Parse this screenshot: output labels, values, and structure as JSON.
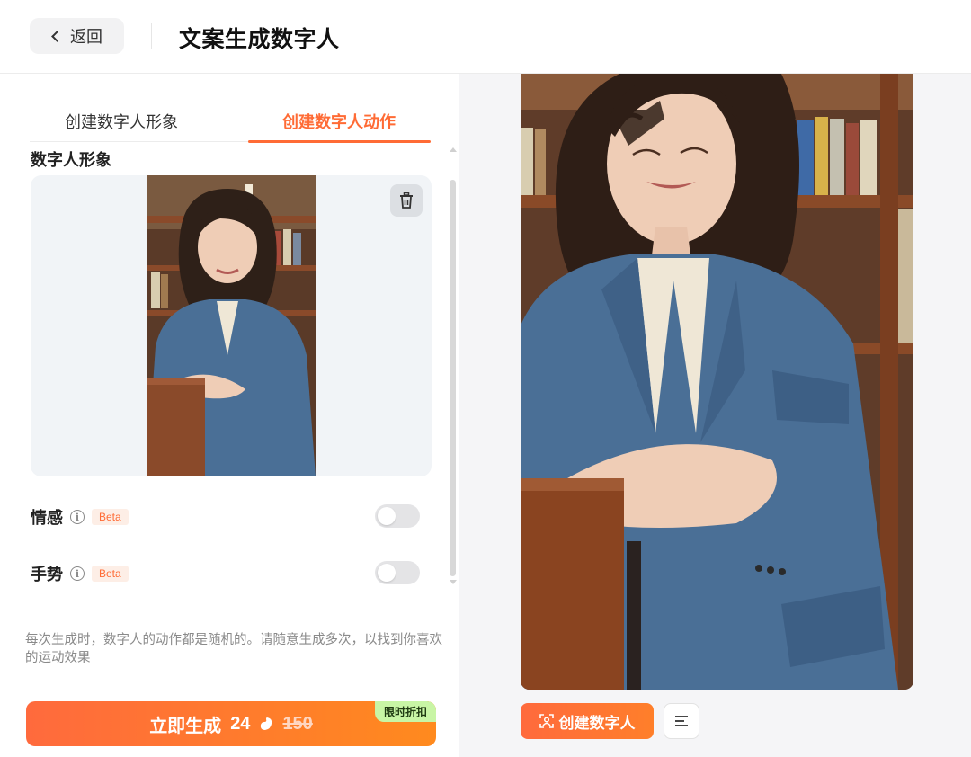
{
  "header": {
    "back_label": "返回",
    "title": "文案生成数字人"
  },
  "tabs": [
    {
      "label": "创建数字人形象",
      "active": false
    },
    {
      "label": "创建数字人动作",
      "active": true
    }
  ],
  "avatar_section": {
    "title": "数字人形象",
    "photo_description": "woman in blue blazer in library",
    "delete_icon": "trash-icon"
  },
  "options": [
    {
      "label": "情感",
      "badge": "Beta",
      "enabled": false
    },
    {
      "label": "手势",
      "badge": "Beta",
      "enabled": false
    }
  ],
  "hint": "每次生成时，数字人的动作都是随机的。请随意生成多次，以找到你喜欢的运动效果",
  "generate": {
    "label": "立即生成",
    "price": "24",
    "original_price": "150",
    "promo": "限时折扣",
    "coin_icon": "bean-coin-icon"
  },
  "preview": {
    "create_button": "创建数字人",
    "create_icon": "face-scan-icon",
    "menu_icon": "menu-lines-icon"
  },
  "colors": {
    "accent": "#ff6b35",
    "promo_bg": "#c8f5a5",
    "beta_bg": "#fdeee6"
  }
}
